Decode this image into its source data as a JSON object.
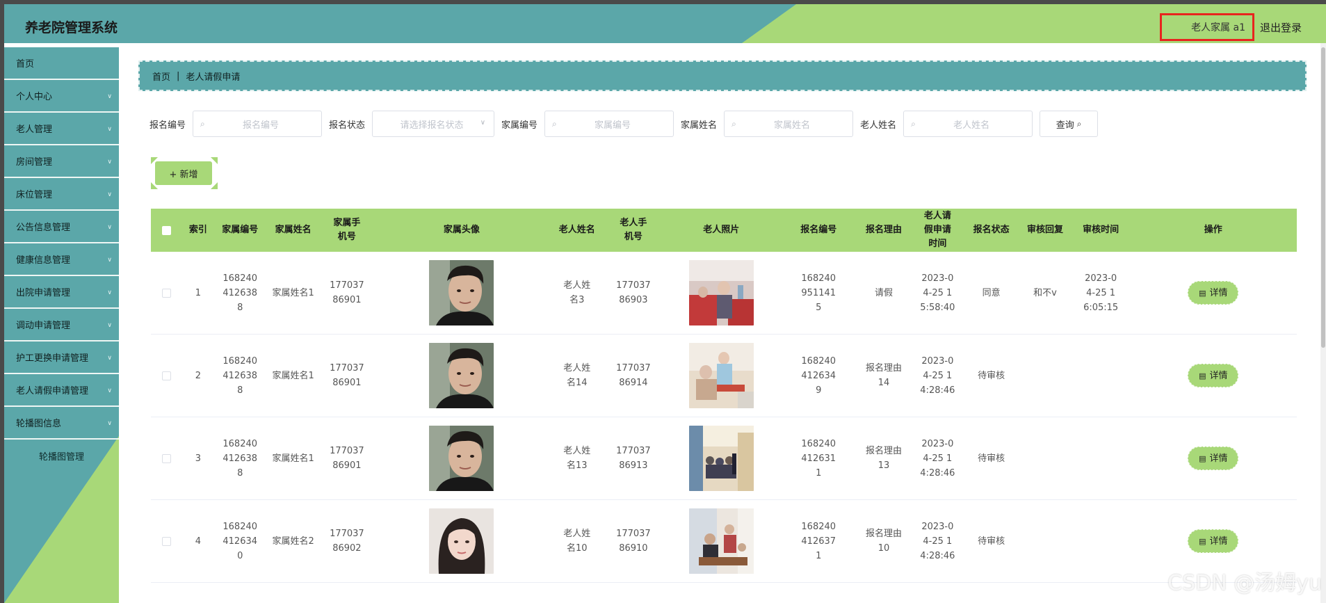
{
  "app": {
    "title": "养老院管理系统",
    "user_label": "老人家属 a1",
    "logout_label": "退出登录",
    "watermark": "CSDN @汤姆yu"
  },
  "colors": {
    "teal": "#5ba7a9",
    "green": "#a8d878",
    "highlight": "#e8241e"
  },
  "sidebar": {
    "items": [
      {
        "label": "首页",
        "has_children": false
      },
      {
        "label": "个人中心",
        "has_children": true
      },
      {
        "label": "老人管理",
        "has_children": true
      },
      {
        "label": "房间管理",
        "has_children": true
      },
      {
        "label": "床位管理",
        "has_children": true
      },
      {
        "label": "公告信息管理",
        "has_children": true
      },
      {
        "label": "健康信息管理",
        "has_children": true
      },
      {
        "label": "出院申请管理",
        "has_children": true
      },
      {
        "label": "调动申请管理",
        "has_children": true
      },
      {
        "label": "护工更换申请管理",
        "has_children": true
      },
      {
        "label": "老人请假申请管理",
        "has_children": true
      },
      {
        "label": "轮播图信息",
        "has_children": true,
        "expanded": true
      }
    ],
    "sub_items": [
      {
        "label": "轮播图管理"
      }
    ]
  },
  "breadcrumb": {
    "home": "首页",
    "separator": "|",
    "current": "老人请假申请"
  },
  "search": {
    "fields": [
      {
        "label": "报名编号",
        "placeholder": "报名编号",
        "type": "input"
      },
      {
        "label": "报名状态",
        "placeholder": "请选择报名状态",
        "type": "select"
      },
      {
        "label": "家属编号",
        "placeholder": "家属编号",
        "type": "input"
      },
      {
        "label": "家属姓名",
        "placeholder": "家属姓名",
        "type": "input"
      },
      {
        "label": "老人姓名",
        "placeholder": "老人姓名",
        "type": "input"
      }
    ],
    "query_label": "查询"
  },
  "add_label": "+ 新增",
  "table": {
    "headers": [
      "",
      "索引",
      "家属编号",
      "家属姓名",
      "家属手机号",
      "家属头像",
      "老人姓名",
      "老人手机号",
      "老人照片",
      "报名编号",
      "报名理由",
      "老人请假申请时间",
      "报名状态",
      "审核回复",
      "审核时间",
      "操作"
    ],
    "rows": [
      {
        "index": "1",
        "family_no": "1682404126388",
        "family_name": "家属姓名1",
        "family_phone": "17703786901",
        "elder_name": "老人姓名3",
        "elder_phone": "17703786903",
        "apply_no": "1682409511415",
        "reason": "请假",
        "apply_time": "2023-04-25 15:58:40",
        "status": "同意",
        "reply": "和不v",
        "review_time": "2023-04-25 16:05:15",
        "avatar": "man",
        "photo": "ward"
      },
      {
        "index": "2",
        "family_no": "1682404126388",
        "family_name": "家属姓名1",
        "family_phone": "17703786901",
        "elder_name": "老人姓名14",
        "elder_phone": "17703786914",
        "apply_no": "1682404126349",
        "reason": "报名理由14",
        "apply_time": "2023-04-25 14:28:46",
        "status": "待审核",
        "reply": "",
        "review_time": "",
        "avatar": "man",
        "photo": "care"
      },
      {
        "index": "3",
        "family_no": "1682404126388",
        "family_name": "家属姓名1",
        "family_phone": "17703786901",
        "elder_name": "老人姓名13",
        "elder_phone": "17703786913",
        "apply_no": "1682404126311",
        "reason": "报名理由13",
        "apply_time": "2023-04-25 14:28:46",
        "status": "待审核",
        "reply": "",
        "review_time": "",
        "avatar": "man",
        "photo": "hall"
      },
      {
        "index": "4",
        "family_no": "1682404126340",
        "family_name": "家属姓名2",
        "family_phone": "17703786902",
        "elder_name": "老人姓名10",
        "elder_phone": "17703786910",
        "apply_no": "1682404126371",
        "reason": "报名理由10",
        "apply_time": "2023-04-25 14:28:46",
        "status": "待审核",
        "reply": "",
        "review_time": "",
        "avatar": "woman",
        "photo": "table"
      }
    ],
    "detail_label": "详情"
  }
}
